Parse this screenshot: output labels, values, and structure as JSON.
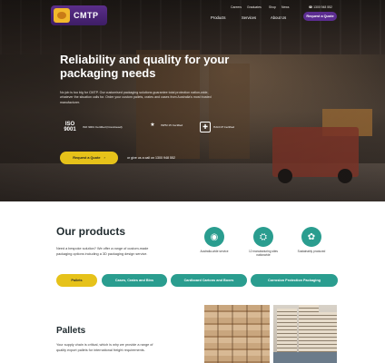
{
  "header": {
    "logo_text": "CMTP",
    "utility_links": [
      "Careers",
      "Graduates",
      "Shop",
      "News"
    ],
    "phone": "1300 948 552",
    "nav": [
      "Products",
      "Services",
      "About Us"
    ],
    "quote_button": "Request a Quote"
  },
  "hero": {
    "title": "Reliability and quality for your packaging needs",
    "text": "No job is too big for CMTP. Our customised packaging solutions guarantee total protection nation-wide, whatever the situation calls for. Order your custom pallets, crates and cases from Australia's most trusted manufacturer.",
    "certifications": [
      {
        "badge": "ISO 9001",
        "label": "ISO 9001 Certified (Crestmead)"
      },
      {
        "badge": "ISPM",
        "label": "ISPM 15 Certified"
      },
      {
        "badge": "HACCP",
        "label": "HACCP Certified"
      }
    ],
    "cta_label": "Request a Quote",
    "cta_arrow": "›",
    "phone_line": "or give us a call on 1300 948 552"
  },
  "products": {
    "title": "Our products",
    "text": "Need a bespoke solution? We offer a range of custom-made packaging options including a 3D packaging design service.",
    "features": [
      {
        "icon": "australia-icon",
        "label": "Australia-wide service"
      },
      {
        "icon": "factory-icon",
        "label": "12 manufacturing sites nationwide"
      },
      {
        "icon": "leaf-icon",
        "label": "Sustainably produced"
      }
    ],
    "tabs": [
      "Pallets",
      "Cases, Crates and Bins",
      "Cardboard Cartons and Boxes",
      "Corrosion Protection Packaging"
    ]
  },
  "pallets": {
    "title": "Pallets",
    "text": "Your supply chain is critical, which is why we provide a range of quality export pallets for international freight requirements."
  },
  "colors": {
    "purple": "#5c2d91",
    "yellow": "#e6c21a",
    "teal": "#2a9d8f"
  }
}
